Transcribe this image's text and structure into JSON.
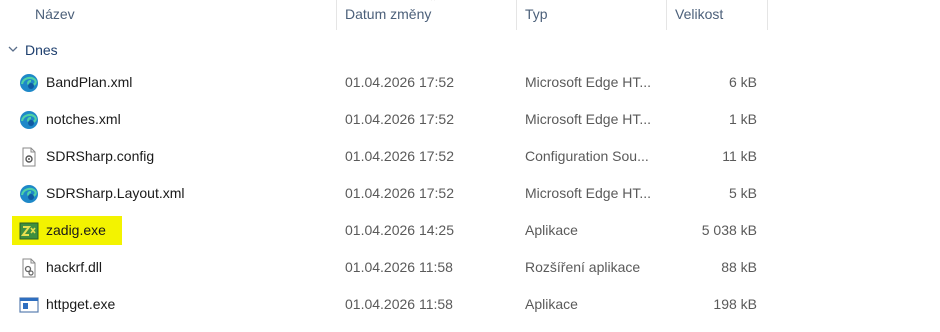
{
  "columns": {
    "name": "Název",
    "date": "Datum změny",
    "type": "Typ",
    "size": "Velikost"
  },
  "group": {
    "label": "Dnes",
    "icon": "chevron-down-icon"
  },
  "files": [
    {
      "name": "BandPlan.xml",
      "date": "01.04.2026 17:52",
      "type": "Microsoft Edge HT...",
      "size": "6 kB",
      "icon": "edge-icon"
    },
    {
      "name": "notches.xml",
      "date": "01.04.2026 17:52",
      "type": "Microsoft Edge HT...",
      "size": "1 kB",
      "icon": "edge-icon"
    },
    {
      "name": "SDRSharp.config",
      "date": "01.04.2026 17:52",
      "type": "Configuration Sou...",
      "size": "11 kB",
      "icon": "config-file-icon"
    },
    {
      "name": "SDRSharp.Layout.xml",
      "date": "01.04.2026 17:52",
      "type": "Microsoft Edge HT...",
      "size": "5 kB",
      "icon": "edge-icon"
    },
    {
      "name": "zadig.exe",
      "date": "01.04.2026 14:25",
      "type": "Aplikace",
      "size": "5 038 kB",
      "icon": "zadig-app-icon",
      "highlight_color": "#f3f300"
    },
    {
      "name": "hackrf.dll",
      "date": "01.04.2026 11:58",
      "type": "Rozšíření aplikace",
      "size": "88 kB",
      "icon": "dll-file-icon"
    },
    {
      "name": "httpget.exe",
      "date": "01.04.2026 11:58",
      "type": "Aplikace",
      "size": "198 kB",
      "icon": "exe-app-icon"
    }
  ]
}
